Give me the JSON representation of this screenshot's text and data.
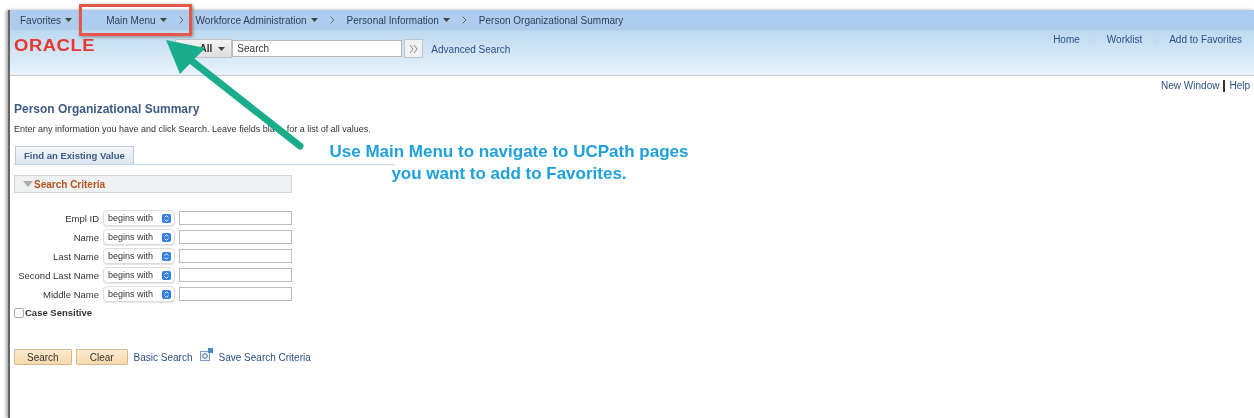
{
  "nav": {
    "items": [
      {
        "label": "Favorites",
        "dropdown": true,
        "chevron_before": false
      },
      {
        "label": "Main Menu",
        "dropdown": true,
        "chevron_before": false
      },
      {
        "label": "Workforce Administration",
        "dropdown": true,
        "chevron_before": true
      },
      {
        "label": "Personal Information",
        "dropdown": true,
        "chevron_before": true
      },
      {
        "label": "Person Organizational Summary",
        "dropdown": false,
        "chevron_before": true
      }
    ]
  },
  "header": {
    "logo": "ORACLE",
    "search": {
      "scope": "All",
      "placeholder": "Search"
    },
    "advanced_search": "Advanced Search",
    "links": [
      "Home",
      "Worklist",
      "Add to Favorites"
    ]
  },
  "page_links": [
    "New Window",
    "Help"
  ],
  "page_title": "Person Organizational Summary",
  "instructions": [
    "Enter any information you have and click Search. Leave fields bla",
    "for a list of all values."
  ],
  "tabs": [
    {
      "label": "Find an Existing Value",
      "selected": true
    }
  ],
  "section": {
    "title": "Search Criteria",
    "expanded": true
  },
  "fields": [
    {
      "label": "Empl ID",
      "operator": "begins with"
    },
    {
      "label": "Name",
      "operator": "begins with"
    },
    {
      "label": "Last Name",
      "operator": "begins with"
    },
    {
      "label": "Second Last Name",
      "operator": "begins with"
    },
    {
      "label": "Middle Name",
      "operator": "begins with"
    }
  ],
  "case_sensitive": {
    "label": "Case Sensitive",
    "checked": false
  },
  "buttons": [
    "Search",
    "Clear"
  ],
  "links": [
    {
      "label": "Basic Search",
      "icon": false
    },
    {
      "label": "Save Search Criteria",
      "icon": true
    }
  ],
  "annotation": {
    "callout": "Use Main Menu to navigate to UCPath pages you want to add to Favorites."
  }
}
